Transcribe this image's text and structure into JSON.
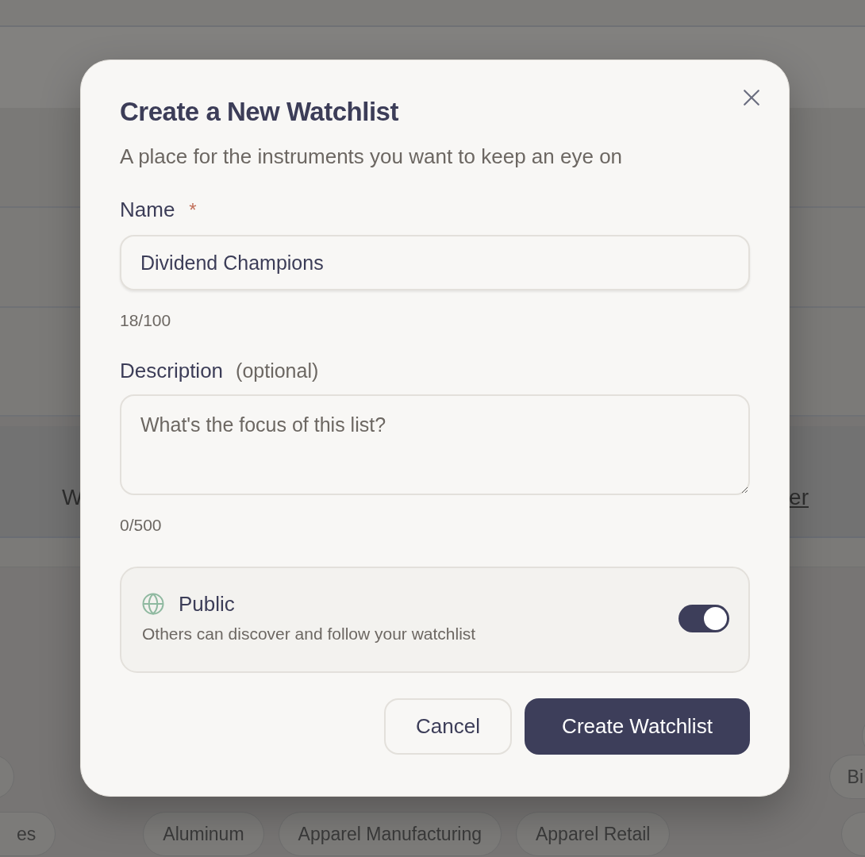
{
  "background": {
    "banner_text": "W",
    "banner_link": "er",
    "chip_rows": [
      {
        "chips": [
          {
            "label": "Bi"
          }
        ]
      },
      {
        "chips": [
          {
            "label": "es"
          },
          {
            "label": "Aluminum"
          },
          {
            "label": "Apparel Manufacturing"
          },
          {
            "label": "Apparel Retail"
          }
        ]
      }
    ]
  },
  "dialog": {
    "title": "Create a New Watchlist",
    "subtitle": "A place for the instruments you want to keep an eye on",
    "name_field": {
      "label": "Name",
      "required_mark": "*",
      "value": "Dividend Champions",
      "counter": "18/100"
    },
    "description_field": {
      "label": "Description",
      "optional_note": "(optional)",
      "placeholder": "What's the focus of this list?",
      "counter": "0/500"
    },
    "visibility": {
      "label": "Public",
      "description": "Others can discover and follow your watchlist",
      "on": true
    },
    "buttons": [
      {
        "label": "Cancel",
        "kind": "secondary"
      },
      {
        "label": "Create Watchlist",
        "kind": "primary"
      }
    ]
  }
}
